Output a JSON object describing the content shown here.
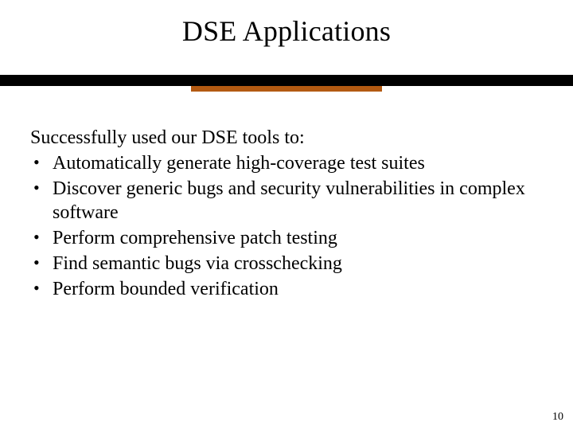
{
  "title": "DSE Applications",
  "intro": "Successfully used our DSE tools to:",
  "bullets": [
    "Automatically generate high-coverage test suites",
    "Discover generic bugs and security vulnerabilities in complex software",
    "Perform comprehensive patch testing",
    "Find semantic bugs via crosschecking",
    "Perform bounded verification"
  ],
  "page_number": "10",
  "colors": {
    "divider": "#000000",
    "accent": "#b35a12"
  }
}
